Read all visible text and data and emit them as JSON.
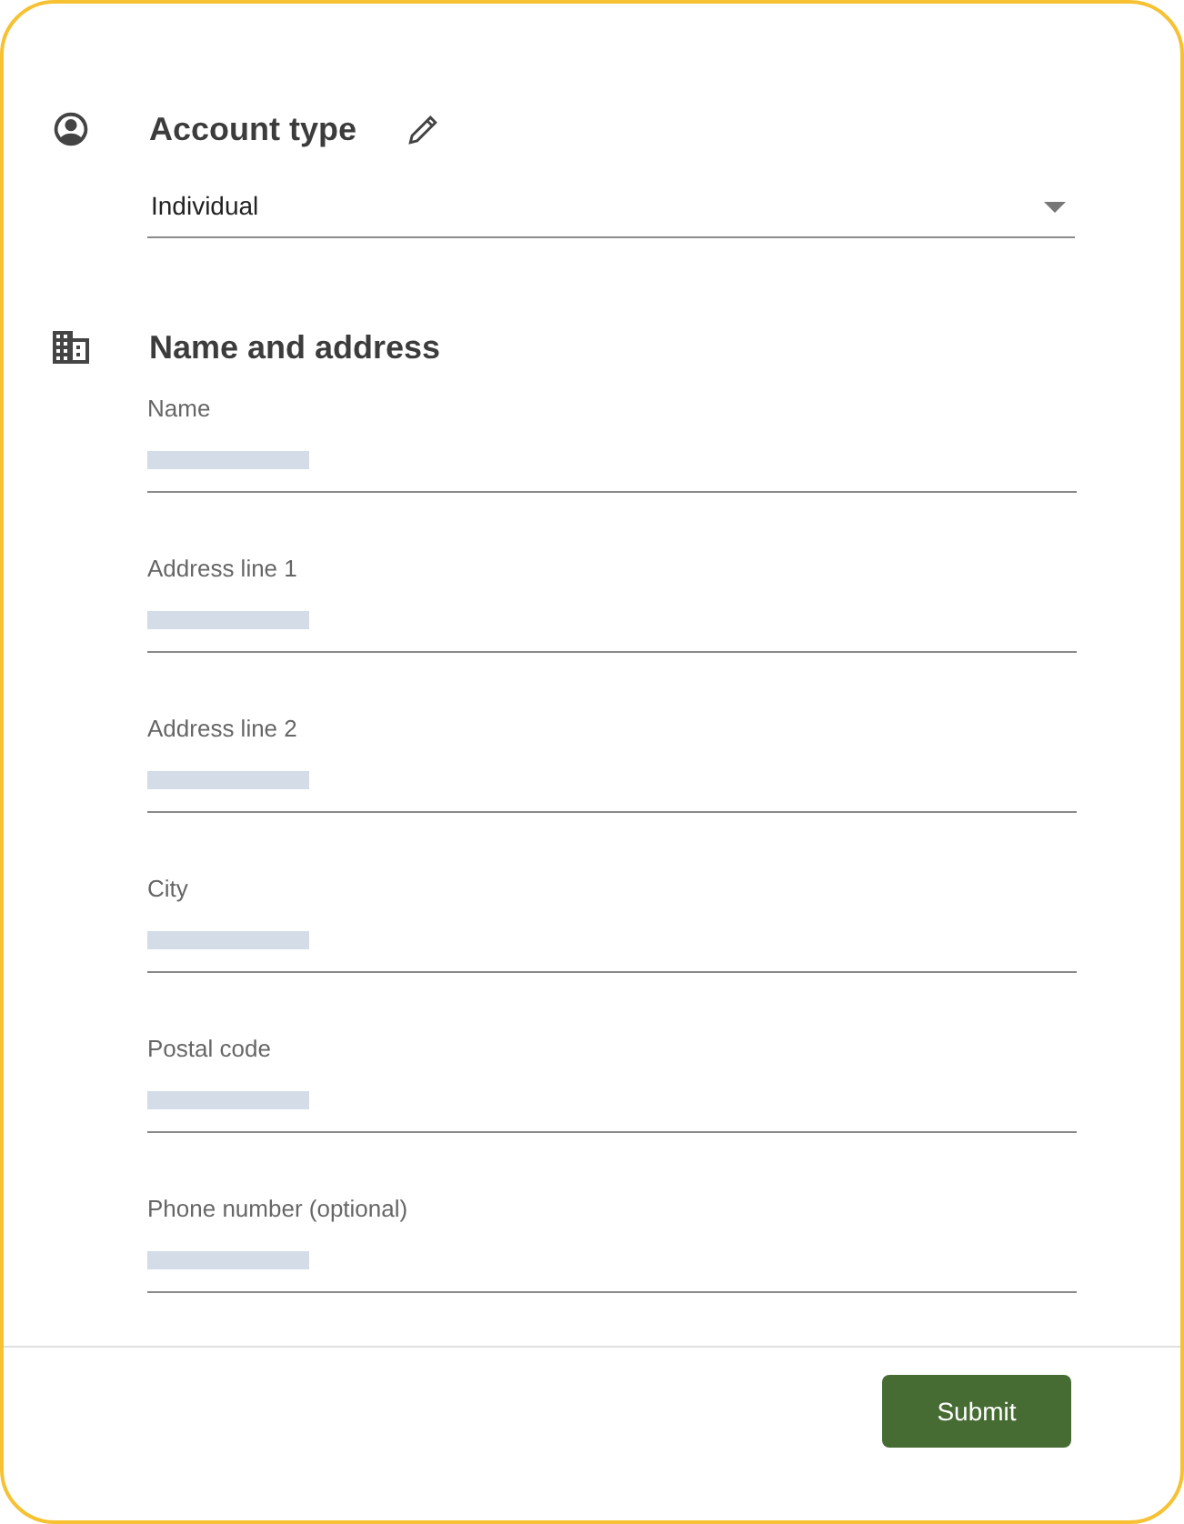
{
  "account_type": {
    "title": "Account type",
    "value": "Individual"
  },
  "name_and_address": {
    "title": "Name and address",
    "fields": [
      {
        "label": "Name"
      },
      {
        "label": "Address line 1"
      },
      {
        "label": "Address line 2"
      },
      {
        "label": "City"
      },
      {
        "label": "Postal code"
      },
      {
        "label": "Phone number (optional)"
      }
    ]
  },
  "buttons": [
    {
      "label": "Submit"
    }
  ]
}
